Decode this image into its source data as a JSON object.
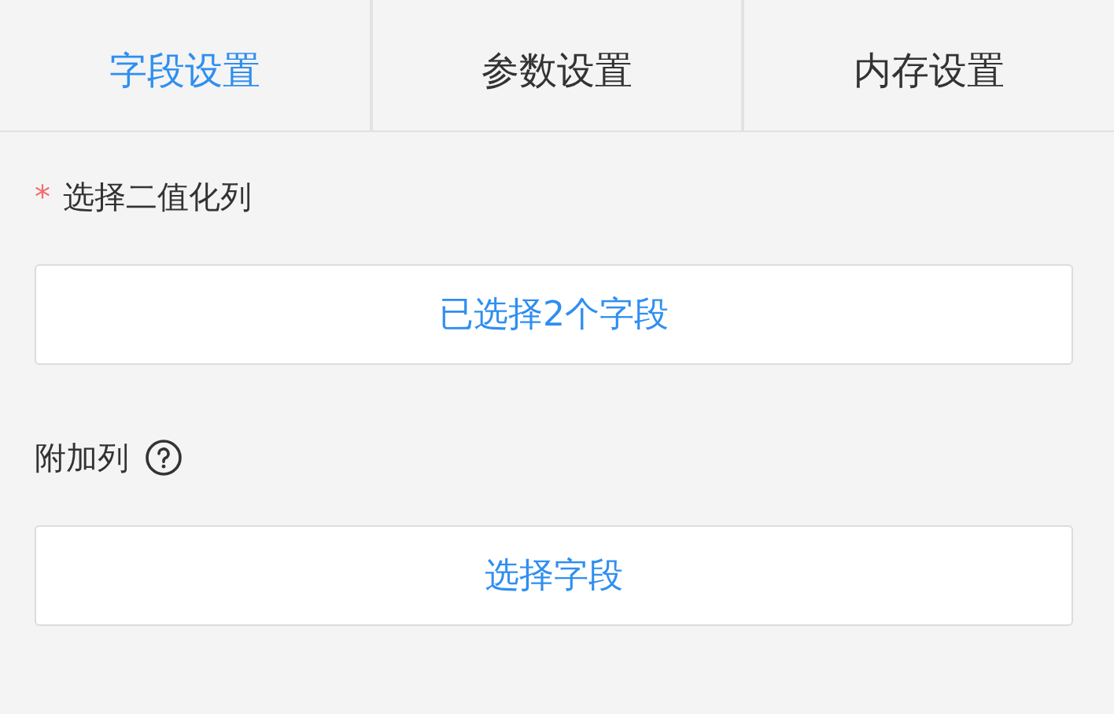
{
  "tabs": [
    {
      "label": "字段设置",
      "selected": true
    },
    {
      "label": "参数设置",
      "selected": false
    },
    {
      "label": "内存设置",
      "selected": false
    }
  ],
  "fields": [
    {
      "label": "选择二值化列",
      "required_mark": "*",
      "help": false,
      "button": "已选择2个字段"
    },
    {
      "label": "附加列",
      "help": true,
      "button": "选择字段"
    }
  ]
}
